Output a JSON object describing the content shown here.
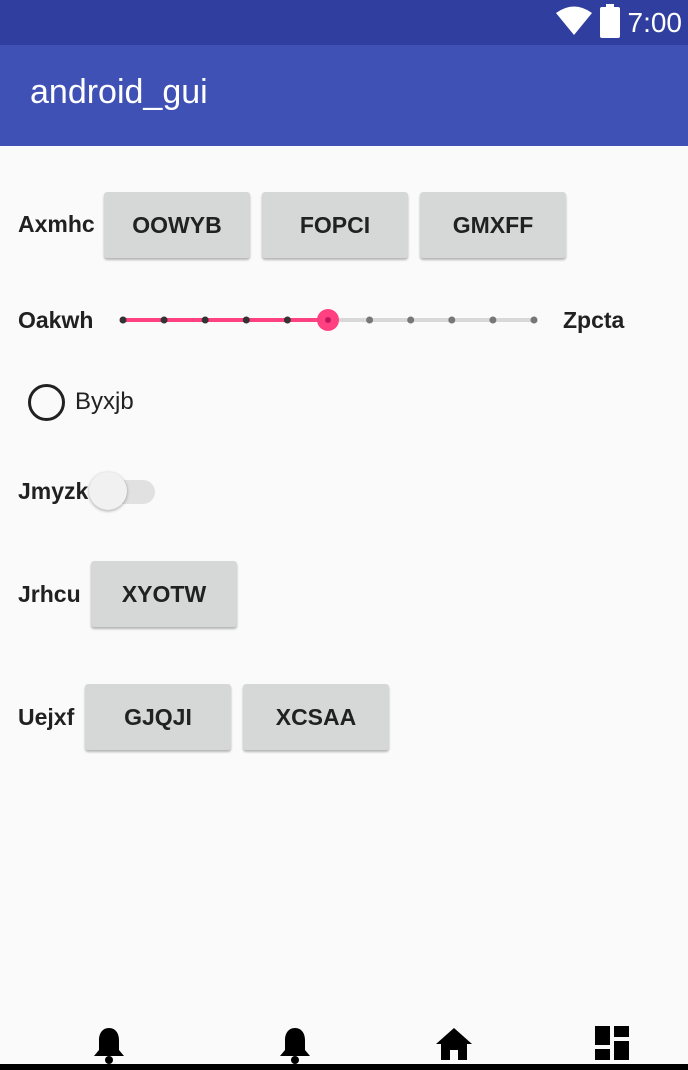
{
  "status_bar": {
    "time": "7:00",
    "icons": [
      "wifi-icon",
      "battery-icon"
    ],
    "color": "#303f9f"
  },
  "app_bar": {
    "title": "android_gui",
    "color": "#3f51b5"
  },
  "rows": {
    "row1": {
      "label": "Axmhc",
      "buttons": [
        "OOWYB",
        "FOPCI",
        "GMXFF"
      ]
    },
    "slider": {
      "start_label": "Oakwh",
      "end_label": "Zpcta",
      "steps": 10,
      "value": 5,
      "accent": "#ff4081"
    },
    "radio": {
      "label": "Byxjb",
      "checked": false
    },
    "switch": {
      "label": "Jmyzk",
      "on": false
    },
    "row5": {
      "label": "Jrhcu",
      "buttons": [
        "XYOTW"
      ]
    },
    "row6": {
      "label": "Uejxf",
      "buttons": [
        "GJQJI",
        "XCSAA"
      ]
    }
  },
  "bottom_nav": {
    "icons": [
      "bell-icon",
      "bell-icon",
      "home-icon",
      "dashboard-icon"
    ]
  }
}
